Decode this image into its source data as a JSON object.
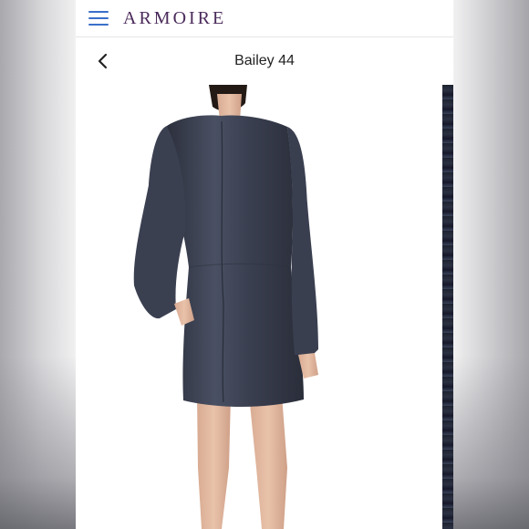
{
  "app": {
    "brand": "ARMOIRE"
  },
  "header": {
    "menu_icon": "hamburger-icon"
  },
  "nav": {
    "back_icon": "chevron-left-icon",
    "title": "Bailey 44"
  },
  "photo": {
    "description_icon": "product-photo"
  },
  "colors": {
    "brand": "#4a2a5a",
    "menu": "#3b6fc9",
    "dress": "#3c4152"
  }
}
